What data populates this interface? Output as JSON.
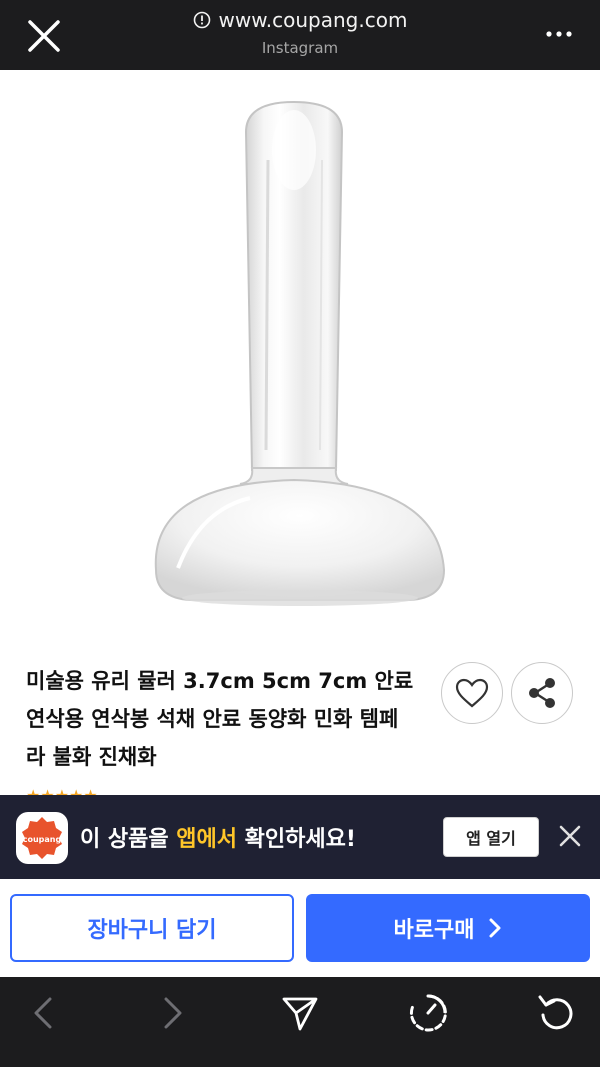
{
  "browser": {
    "url": "www.coupang.com",
    "source": "Instagram",
    "icons": {
      "close": "close-icon",
      "info": "info-icon",
      "more": "more-icon"
    }
  },
  "product": {
    "title": "미술용 유리 뮬러 3.7cm 5cm 7cm 안료 연삭용 연삭봉 석채 안료 동양화 민화 템페라 불화 진채화",
    "image": "glass-muller-image",
    "rating_stars": "★★★★★"
  },
  "app_banner": {
    "text_pre": "이 상품을 ",
    "text_highlight": "앱에서",
    "text_post": " 확인하세요!",
    "logo_text": "coupang",
    "open_button": "앱 열기",
    "colors": {
      "background": "#1f2133",
      "highlight": "#ffc629",
      "logo": "#e8532c"
    }
  },
  "actions": {
    "cart_label": "장바구니 담기",
    "buy_label": "바로구매",
    "colors": {
      "primary": "#346aff"
    }
  },
  "bottom_nav": {
    "icons": [
      "back-icon",
      "forward-icon",
      "send-icon",
      "timer-icon",
      "refresh-icon"
    ]
  }
}
